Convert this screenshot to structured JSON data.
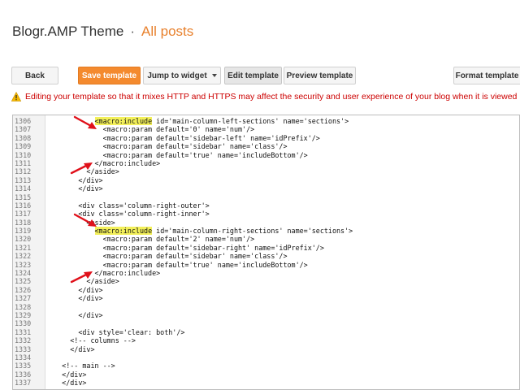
{
  "header": {
    "theme_title": "Blogr.AMP Theme",
    "separator": "·",
    "posts_link": "All posts"
  },
  "toolbar": {
    "back": "Back",
    "save_template": "Save template",
    "jump_to_widget": "Jump to widget",
    "edit_template": "Edit template",
    "preview_template": "Preview template",
    "format_template": "Format template"
  },
  "warning": {
    "icon": "warning-triangle-icon",
    "text": "Editing your template so that it mixes HTTP and HTTPS may affect the security and user experience of your blog when it is viewed"
  },
  "editor": {
    "lines": [
      {
        "n": "1306",
        "pre": "            ",
        "hl": "<macro:include",
        "post": " id='main-column-left-sections' name='sections'>"
      },
      {
        "n": "1307",
        "pre": "",
        "hl": "",
        "post": "              <macro:param default='0' name='num'/>"
      },
      {
        "n": "1308",
        "pre": "",
        "hl": "",
        "post": "              <macro:param default='sidebar-left' name='idPrefix'/>"
      },
      {
        "n": "1309",
        "pre": "",
        "hl": "",
        "post": "              <macro:param default='sidebar' name='class'/>"
      },
      {
        "n": "1310",
        "pre": "",
        "hl": "",
        "post": "              <macro:param default='true' name='includeBottom'/>"
      },
      {
        "n": "1311",
        "pre": "",
        "hl": "",
        "post": "            </macro:include>"
      },
      {
        "n": "1312",
        "pre": "",
        "hl": "",
        "post": "          </aside>"
      },
      {
        "n": "1313",
        "pre": "",
        "hl": "",
        "post": "        </div>"
      },
      {
        "n": "1314",
        "pre": "",
        "hl": "",
        "post": "        </div>"
      },
      {
        "n": "1315",
        "pre": "",
        "hl": "",
        "post": ""
      },
      {
        "n": "1316",
        "pre": "",
        "hl": "",
        "post": "        <div class='column-right-outer'>"
      },
      {
        "n": "1317",
        "pre": "",
        "hl": "",
        "post": "        <div class='column-right-inner'>"
      },
      {
        "n": "1318",
        "pre": "",
        "hl": "",
        "post": "          <aside>"
      },
      {
        "n": "1319",
        "pre": "            ",
        "hl": "<macro:include",
        "post": " id='main-column-right-sections' name='sections'>"
      },
      {
        "n": "1320",
        "pre": "",
        "hl": "",
        "post": "              <macro:param default='2' name='num'/>"
      },
      {
        "n": "1321",
        "pre": "",
        "hl": "",
        "post": "              <macro:param default='sidebar-right' name='idPrefix'/>"
      },
      {
        "n": "1322",
        "pre": "",
        "hl": "",
        "post": "              <macro:param default='sidebar' name='class'/>"
      },
      {
        "n": "1323",
        "pre": "",
        "hl": "",
        "post": "              <macro:param default='true' name='includeBottom'/>"
      },
      {
        "n": "1324",
        "pre": "",
        "hl": "",
        "post": "            </macro:include>"
      },
      {
        "n": "1325",
        "pre": "",
        "hl": "",
        "post": "          </aside>"
      },
      {
        "n": "1326",
        "pre": "",
        "hl": "",
        "post": "        </div>"
      },
      {
        "n": "1327",
        "pre": "",
        "hl": "",
        "post": "        </div>"
      },
      {
        "n": "1328",
        "pre": "",
        "hl": "",
        "post": ""
      },
      {
        "n": "1329",
        "pre": "",
        "hl": "",
        "post": "        </div>"
      },
      {
        "n": "1330",
        "pre": "",
        "hl": "",
        "post": ""
      },
      {
        "n": "1331",
        "pre": "",
        "hl": "",
        "post": "        <div style='clear: both'/>"
      },
      {
        "n": "1332",
        "pre": "",
        "hl": "",
        "post": "      <!-- columns -->"
      },
      {
        "n": "1333",
        "pre": "",
        "hl": "",
        "post": "      </div>"
      },
      {
        "n": "1334",
        "pre": "",
        "hl": "",
        "post": ""
      },
      {
        "n": "1335",
        "pre": "",
        "hl": "",
        "post": "    <!-- main -->"
      },
      {
        "n": "1336",
        "pre": "",
        "hl": "",
        "post": "    </div>"
      },
      {
        "n": "1337",
        "pre": "",
        "hl": "",
        "post": "    </div>"
      }
    ]
  },
  "colors": {
    "accent_orange": "#f48a2e",
    "posts_orange": "#e8812d",
    "warning_red": "#cc0000",
    "highlight_yellow": "#f3f05a",
    "annotation_red": "#e0101a"
  }
}
